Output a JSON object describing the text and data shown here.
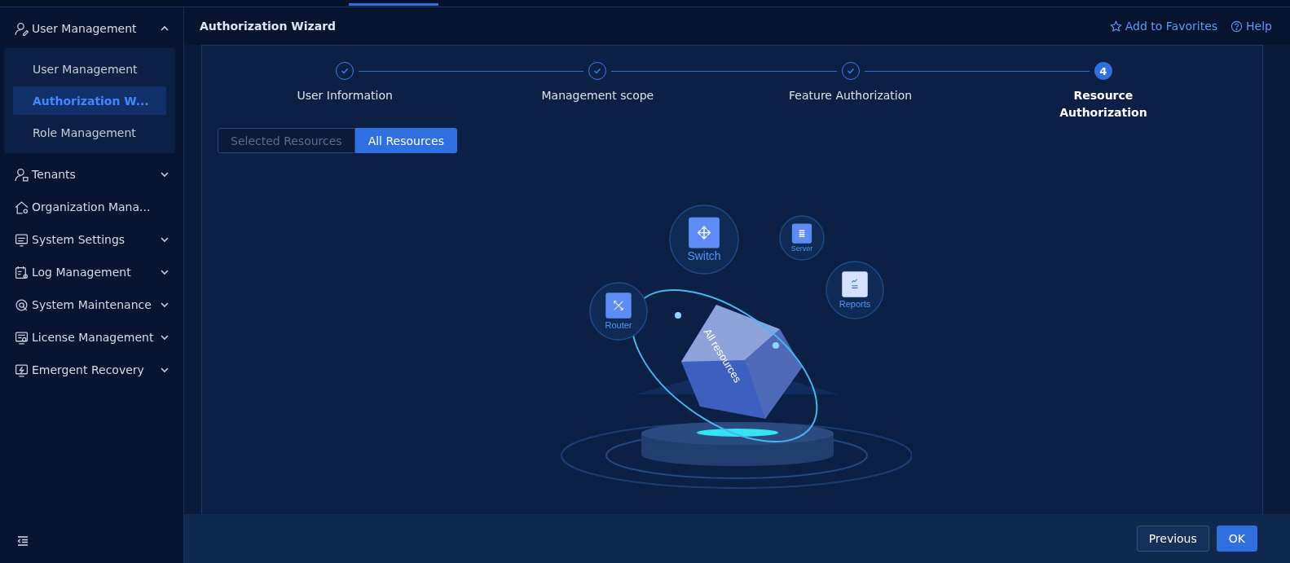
{
  "sidebar": {
    "items": [
      {
        "label": "User Management",
        "kind": "user",
        "expanded": true,
        "children": [
          {
            "label": "User Management",
            "selected": false
          },
          {
            "label": "Authorization W...",
            "selected": true
          },
          {
            "label": "Role Management",
            "selected": false
          }
        ]
      },
      {
        "label": "Tenants",
        "kind": "tenant",
        "expanded": false
      },
      {
        "label": "Organization Mana...",
        "kind": "org"
      },
      {
        "label": "System Settings",
        "kind": "settings",
        "expanded": false
      },
      {
        "label": "Log Management",
        "kind": "log",
        "expanded": false
      },
      {
        "label": "System Maintenance",
        "kind": "maint",
        "expanded": false
      },
      {
        "label": "License Management",
        "kind": "license",
        "expanded": false
      },
      {
        "label": "Emergent Recovery",
        "kind": "recovery",
        "expanded": false
      }
    ]
  },
  "header": {
    "title": "Authorization Wizard",
    "links": [
      {
        "label": "Add to Favorites",
        "kind": "star"
      },
      {
        "label": "Help",
        "kind": "help"
      }
    ]
  },
  "steps": [
    {
      "label": "User Information",
      "done": true
    },
    {
      "label": "Management scope",
      "done": true
    },
    {
      "label": "Feature Authorization",
      "done": true
    },
    {
      "label": "Resource Authorization",
      "done": false,
      "number": "4"
    }
  ],
  "scope_toggle": [
    {
      "label": "Selected Resources",
      "selected": false
    },
    {
      "label": "All Resources",
      "selected": true
    }
  ],
  "illustration": {
    "nodes": [
      {
        "label": "Switch",
        "kind": "switch"
      },
      {
        "label": "Server",
        "kind": "server"
      },
      {
        "label": "Router",
        "kind": "router"
      },
      {
        "label": "Reports",
        "kind": "reports"
      }
    ],
    "cube_label": "All resources"
  },
  "footer": {
    "buttons": [
      {
        "label": "Previous",
        "kind": "secondary"
      },
      {
        "label": "OK",
        "kind": "primary"
      }
    ]
  }
}
